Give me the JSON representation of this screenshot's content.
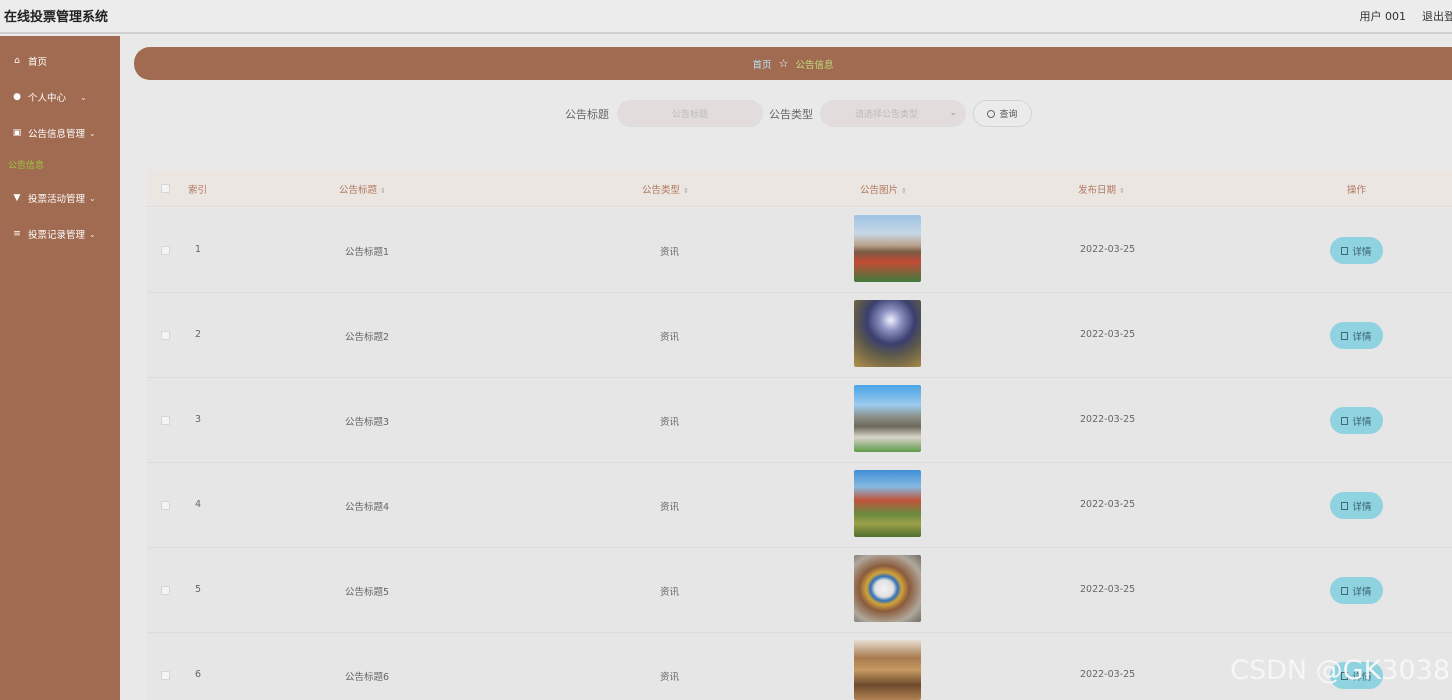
{
  "header": {
    "app_title": "在线投票管理系统",
    "user": "用户 001",
    "logout": "退出登录"
  },
  "sidebar": {
    "items": [
      {
        "label": "首页",
        "icon": "home-icon",
        "has_chevron": false
      },
      {
        "label": "个人中心",
        "icon": "user-icon",
        "has_chevron": true
      },
      {
        "label": "公告信息管理",
        "icon": "notice-icon",
        "has_chevron": true
      },
      {
        "label": "投票活动管理",
        "icon": "vote-icon",
        "has_chevron": true
      },
      {
        "label": "投票记录管理",
        "icon": "list-icon",
        "has_chevron": true
      }
    ],
    "active_subitem": "公告信息"
  },
  "breadcrumb": {
    "home": "首页",
    "current": "公告信息"
  },
  "search": {
    "title_label": "公告标题",
    "title_placeholder": "公告标题",
    "type_label": "公告类型",
    "type_placeholder": "请选择公告类型",
    "button_label": "查询"
  },
  "table": {
    "columns": [
      "索引",
      "公告标题",
      "公告类型",
      "公告图片",
      "发布日期",
      "操作"
    ],
    "detail_label": "详情",
    "rows": [
      {
        "index": "1",
        "title": "公告标题1",
        "type": "资讯",
        "date": "2022-03-25"
      },
      {
        "index": "2",
        "title": "公告标题2",
        "type": "资讯",
        "date": "2022-03-25"
      },
      {
        "index": "3",
        "title": "公告标题3",
        "type": "资讯",
        "date": "2022-03-25"
      },
      {
        "index": "4",
        "title": "公告标题4",
        "type": "资讯",
        "date": "2022-03-25"
      },
      {
        "index": "5",
        "title": "公告标题5",
        "type": "资讯",
        "date": "2022-03-25"
      },
      {
        "index": "6",
        "title": "公告标题6",
        "type": "资讯",
        "date": "2022-03-25"
      }
    ]
  },
  "watermark": "CSDN @GK3038",
  "colors": {
    "sidebar": "#a06b51",
    "accent_button": "#8fd2e0",
    "active_menu": "#9bc840"
  }
}
